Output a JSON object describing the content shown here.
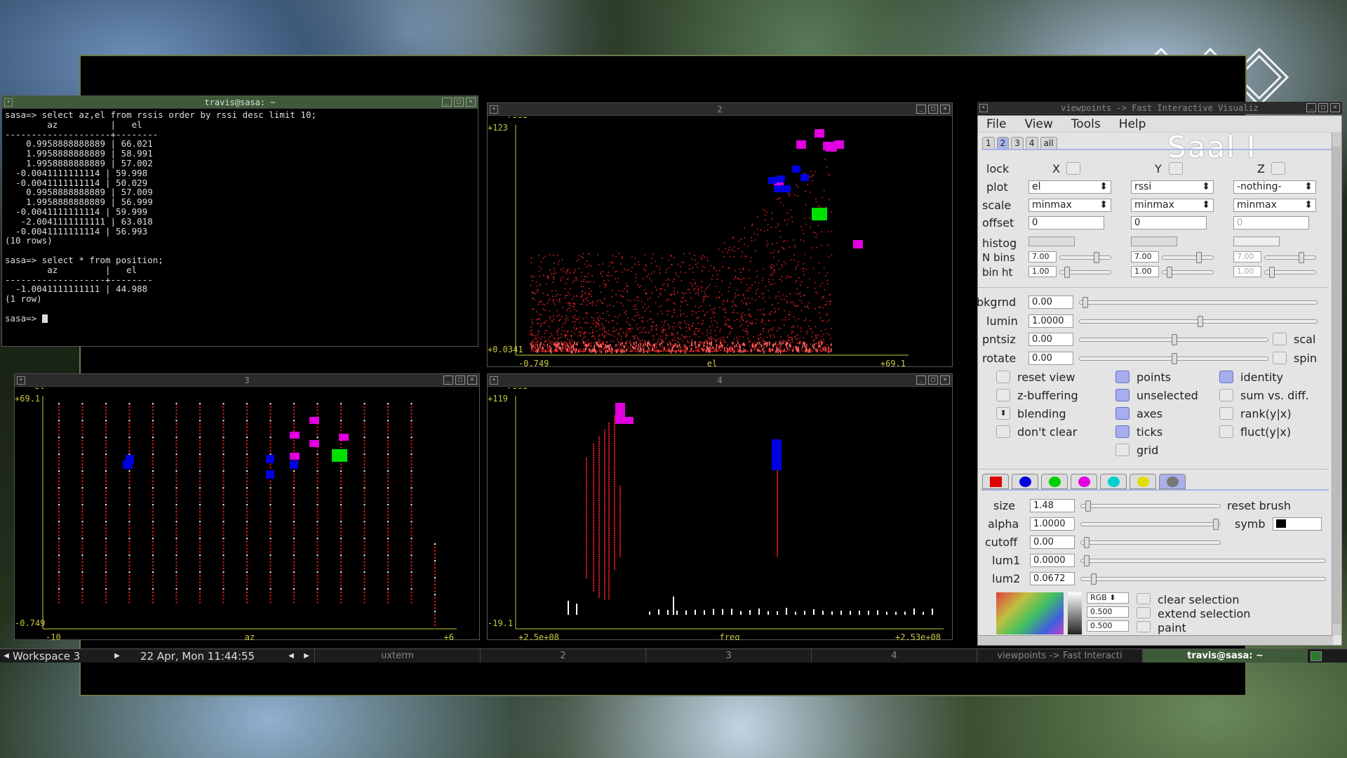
{
  "terminal": {
    "title": "travis@sasa: ~",
    "lines": [
      "sasa=> select az,el from rssis order by rssi desc limit 10;",
      "        az          |   el",
      "--------------------+--------",
      "    0.9958888888889 | 66.021",
      "    1.9958888888889 | 58.991",
      "    1.9958888888889 | 57.002",
      "  -0.0041111111114 | 59.998",
      "  -0.0041111111114 | 50.029",
      "    0.9958888888889 | 57.009",
      "    1.9958888888889 | 56.999",
      "  -0.0041111111114 | 59.999",
      "   -2.0041111111111 | 63.018",
      "  -0.0041111111114 | 56.993",
      "(10 rows)",
      "",
      "sasa=> select * from position;",
      "        az         |   el",
      "-------------------+--------",
      "  -1.0041111111111 | 44.988",
      "(1 row)",
      "",
      "sasa=> "
    ]
  },
  "plot2": {
    "title": "2",
    "ylabel": "rssi",
    "xlabel": "el",
    "ymax": "+123",
    "ymin": "+0.0341",
    "xmin": "-0.749",
    "xmax": "+69.1"
  },
  "plot3": {
    "title": "3",
    "ylabel": "el",
    "xlabel": "az",
    "ymax": "+69.1",
    "ymin": "-0.749",
    "xmin": "-10",
    "xmax": "+6"
  },
  "plot4": {
    "title": "4",
    "ylabel": "rssi",
    "xlabel": "freq",
    "ymax": "+119",
    "ymin": "-19.1",
    "xmin": "+2.5e+08",
    "xmax": "+2.53e+08"
  },
  "viewpoints": {
    "title": "viewpoints -> Fast Interactive Visualiz",
    "menu": [
      "File",
      "View",
      "Tools",
      "Help"
    ],
    "tabs": [
      "1",
      "2",
      "3",
      "4",
      "all"
    ],
    "logo_text": "Saal I",
    "lock": "lock",
    "x": "X",
    "y": "Y",
    "z": "Z",
    "plot": "plot",
    "scale": "scale",
    "offset": "offset",
    "histog": "histog",
    "nbins": "N bins",
    "binht": "bin ht",
    "plot_vals": [
      "el",
      "rssi",
      "-nothing-"
    ],
    "scale_vals": [
      "minmax",
      "minmax",
      "minmax"
    ],
    "offset_vals": [
      "0",
      "0",
      "0"
    ],
    "nbins_vals": [
      "7.00",
      "7.00",
      "7.00"
    ],
    "binht_vals": [
      "1.00",
      "1.00",
      "1.00"
    ],
    "bkgrnd": "bkgrnd",
    "bkgrnd_val": "0.00",
    "lumin": "lumin",
    "lumin_val": "1.0000",
    "pntsiz": "pntsiz",
    "pntsiz_val": "0.00",
    "scal": "scal",
    "rotate": "rotate",
    "rotate_val": "0.00",
    "spin": "spin",
    "cb_left": [
      "reset view",
      "z-buffering",
      "blending",
      "don't clear"
    ],
    "cb_mid": [
      "points",
      "unselected",
      "axes",
      "ticks",
      "grid"
    ],
    "cb_right": [
      "identity",
      "sum vs. diff.",
      "rank(y|x)",
      "fluct(y|x)"
    ],
    "size": "size",
    "size_val": "1.48",
    "reset_brush": "reset brush",
    "alpha": "alpha",
    "alpha_val": "1.0000",
    "symb": "symb",
    "cutoff": "cutoff",
    "cutoff_val": "0.00",
    "lum1": "lum1",
    "lum1_val": "0.0000",
    "lum2": "lum2",
    "lum2_val": "0.0672",
    "rgb": "RGB",
    "rgb1": "0.500",
    "rgb2": "0.500",
    "clear_selection": "clear selection",
    "extend_selection": "extend selection",
    "paint": "paint",
    "brush_colors": [
      "#e00000",
      "#0000e0",
      "#00d000",
      "#e000e0",
      "#00d0d0",
      "#e0e000",
      "#777777"
    ]
  },
  "taskbar": {
    "workspace": "Workspace 3",
    "datetime": "22 Apr, Mon 11:44:55",
    "tasks": [
      "uxterm",
      "2",
      "3",
      "4",
      "viewpoints -> Fast Interacti",
      "travis@sasa: ~"
    ]
  }
}
